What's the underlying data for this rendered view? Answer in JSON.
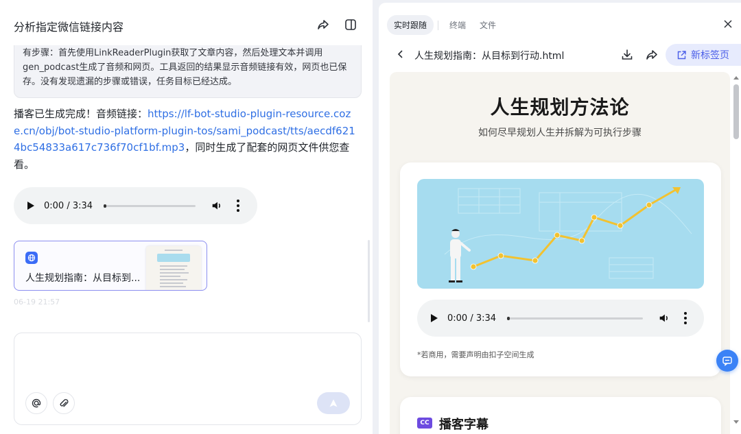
{
  "left": {
    "title": "分析指定微信链接内容",
    "step_summary": "有步骤：首先使用LinkReaderPlugin获取了文章内容，然后处理文本并调用gen_podcast生成了音频和网页。工具返回的结果显示音频链接有效，网页也已保存。没有发现遗漏的步骤或错误，任务目标已经达成。",
    "reply_prefix": "播客已生成完成！音频链接：",
    "reply_link": "https://lf-bot-studio-plugin-resource.coze.cn/obj/bot-studio-platform-plugin-tos/sami_podcast/tts/aecdf6214bc54833a617c736f70cf1bf.mp3",
    "reply_suffix": "，同时生成了配套的网页文件供您查看。",
    "audio_time": "0:00 / 3:34",
    "file_card_name": "人生规划指南：从目标到...",
    "ghost_timestamp": "06-19 21:57"
  },
  "right": {
    "tabs": [
      "实时跟随",
      "终端",
      "文件"
    ],
    "active_tab": 0,
    "doc_title": "人生规划指南：从目标到行动.html",
    "new_tab_label": "新标签页",
    "page": {
      "heading": "人生规划方法论",
      "subheading": "如何尽早规划人生并拆解为可执行步骤",
      "audio_time": "0:00 / 3:34",
      "disclaimer": "*若商用，需要声明由扣子空间生成",
      "section2_badge": "CC",
      "section2_title": "播客字幕"
    }
  },
  "colors": {
    "link": "#2f6fe4",
    "accent": "#4a5ee8",
    "illustration_bg": "#a6dcef",
    "path_yellow": "#f2c230"
  }
}
